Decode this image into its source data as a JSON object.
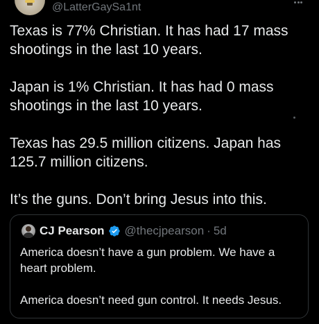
{
  "post": {
    "handle": "@LatterGaySa1nt",
    "paragraphs": [
      "Texas is 77% Christian. It has had 17 mass shootings in the last 10 years.",
      "Japan is 1% Christian. It has had 0 mass shootings in the last 10 years.",
      "Texas has 29.5 million citizens. Japan has 125.7 million citizens.",
      "It’s the guns. Don’t bring Jesus into this."
    ]
  },
  "quote": {
    "name": "CJ Pearson",
    "handle": "@thecjpearson",
    "separator": "·",
    "time": "5d",
    "paragraphs": [
      "America doesn’t have a gun problem. We have a heart problem.",
      "America doesn’t need gun control. It needs Jesus."
    ]
  },
  "colors": {
    "background": "#000000",
    "text": "#e7e9ea",
    "muted": "#71767b",
    "verified": "#1d9bf0",
    "border": "#2f3336"
  },
  "icons": {
    "more": "more-horizontal-icon",
    "verified": "verified-badge-icon"
  }
}
